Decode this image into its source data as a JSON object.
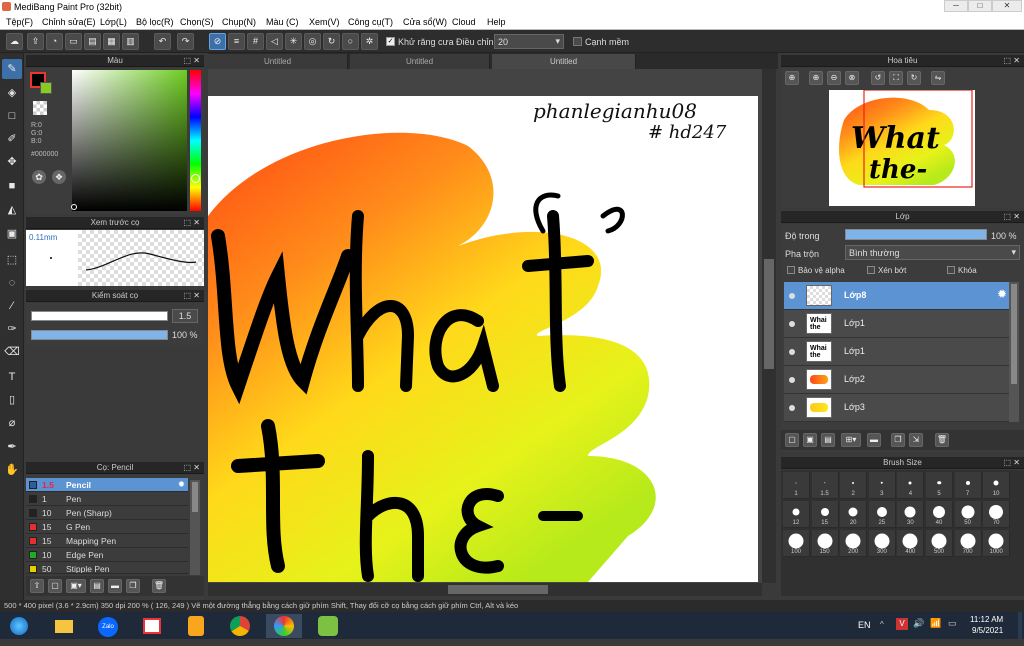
{
  "window": {
    "title": "MediBang Paint Pro (32bit)",
    "minimize": "─",
    "maximize": "□",
    "close": "✕"
  },
  "menu": [
    "Tệp(F)",
    "Chỉnh sửa(E)",
    "Lớp(L)",
    "Bộ lọc(R)",
    "Chọn(S)",
    "Chụp(N)",
    "Màu (C)",
    "Xem(V)",
    "Công cụ(T)",
    "Cửa sổ(W)",
    "Cloud",
    "Help"
  ],
  "toolbar": {
    "antialias_label": "Khử răng cưa",
    "adjust_label": "Điều chỉnh",
    "adjust_value": "20",
    "snap_label": "Cạnh mềm"
  },
  "color_panel": {
    "title": "Màu",
    "r": "R:0",
    "g": "G:0",
    "b": "B:0",
    "hex": "#000000",
    "fg": "#000000",
    "bg": "#ffffff"
  },
  "preview_panel": {
    "title": "Xem trước cọ",
    "size": "0.11mm"
  },
  "brush_control": {
    "title": "Kiểm soát cọ",
    "size": "1.5",
    "opacity": "100 %",
    "opacity_value": 1.0
  },
  "brush_panel": {
    "title": "Cọ: Pencil",
    "items": [
      {
        "size": "1.5",
        "name": "Pencil",
        "color": "#2d5d9a"
      },
      {
        "size": "1",
        "name": "Pen",
        "color": "#222222"
      },
      {
        "size": "10",
        "name": "Pen (Sharp)",
        "color": "#222222"
      },
      {
        "size": "15",
        "name": "G Pen",
        "color": "#e03030"
      },
      {
        "size": "15",
        "name": "Mapping Pen",
        "color": "#e03030"
      },
      {
        "size": "10",
        "name": "Edge Pen",
        "color": "#22aa22"
      },
      {
        "size": "50",
        "name": "Stipple Pen",
        "color": "#e8d000"
      }
    ]
  },
  "tabs": [
    "Untitled",
    "Untitled",
    "Untitled"
  ],
  "artwork": {
    "signature_line1": "phanlegianhu08",
    "signature_line2": "# hd247",
    "word1": "What",
    "word2": "the-"
  },
  "navigator": {
    "title": "Hoa tiêu"
  },
  "layer_panel": {
    "title": "Lớp",
    "opacity_label": "Độ trong",
    "opacity_value": "100 %",
    "opacity_fraction": 1.0,
    "blend_label": "Pha trộn",
    "blend_value": "Bình thường",
    "protect_alpha": "Bảo vệ alpha",
    "clipping": "Xén bớt",
    "lock": "Khóa",
    "layers": [
      {
        "name": "Lớp8",
        "selected": true,
        "thumb": "empty"
      },
      {
        "name": "Lớp1",
        "selected": false,
        "thumb": "text"
      },
      {
        "name": "Lớp1",
        "selected": false,
        "thumb": "text"
      },
      {
        "name": "Lớp2",
        "selected": false,
        "thumb": "orange"
      },
      {
        "name": "Lớp3",
        "selected": false,
        "thumb": "yellow"
      }
    ]
  },
  "brush_size": {
    "title": "Brush Size",
    "sizes": [
      "1",
      "1.5",
      "2",
      "3",
      "4",
      "5",
      "7",
      "10",
      "12",
      "15",
      "20",
      "25",
      "30",
      "40",
      "50",
      "70",
      "100",
      "150",
      "200",
      "300",
      "400",
      "500",
      "700",
      "1000"
    ]
  },
  "status": {
    "text": "500 * 400 pixel  (3.6 * 2.9cm)  350 dpi  200 %  ( 126, 249 )  Vẽ một đường thẳng bằng cách giữ phím Shift, Thay đổi cỡ cọ bằng cách giữ phím Ctrl, Alt và kéo"
  },
  "taskbar": {
    "lang": "EN",
    "time": "11:12 AM",
    "date": "9/5/2021"
  }
}
